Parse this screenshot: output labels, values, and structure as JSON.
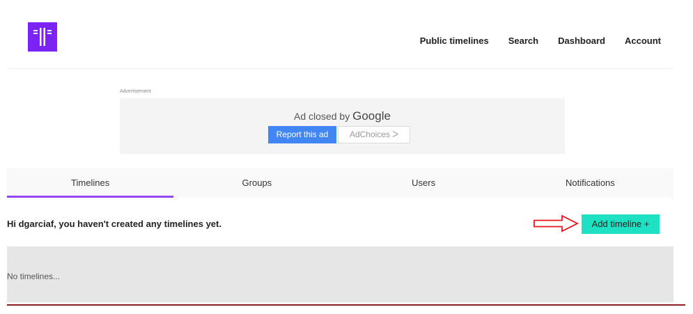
{
  "nav": {
    "items": [
      "Public timelines",
      "Search",
      "Dashboard",
      "Account"
    ]
  },
  "ad": {
    "label": "Advertisement",
    "closed_text": "Ad closed by",
    "brand": "Google",
    "report_label": "Report this ad",
    "adchoices_label": "AdChoices ᐳ"
  },
  "tabs": [
    "Timelines",
    "Groups",
    "Users",
    "Notifications"
  ],
  "active_tab": "Timelines",
  "main": {
    "greeting": "Hi dgarciaf, you haven't created any timelines yet.",
    "add_button_label": "Add timeline +",
    "empty_text": "No timelines..."
  },
  "colors": {
    "brand": "#7b22f5",
    "tab_indicator": "#9447ee",
    "add_button": "#1ee0c2",
    "report_button": "#4285f4",
    "arrow": "#e8141c"
  }
}
